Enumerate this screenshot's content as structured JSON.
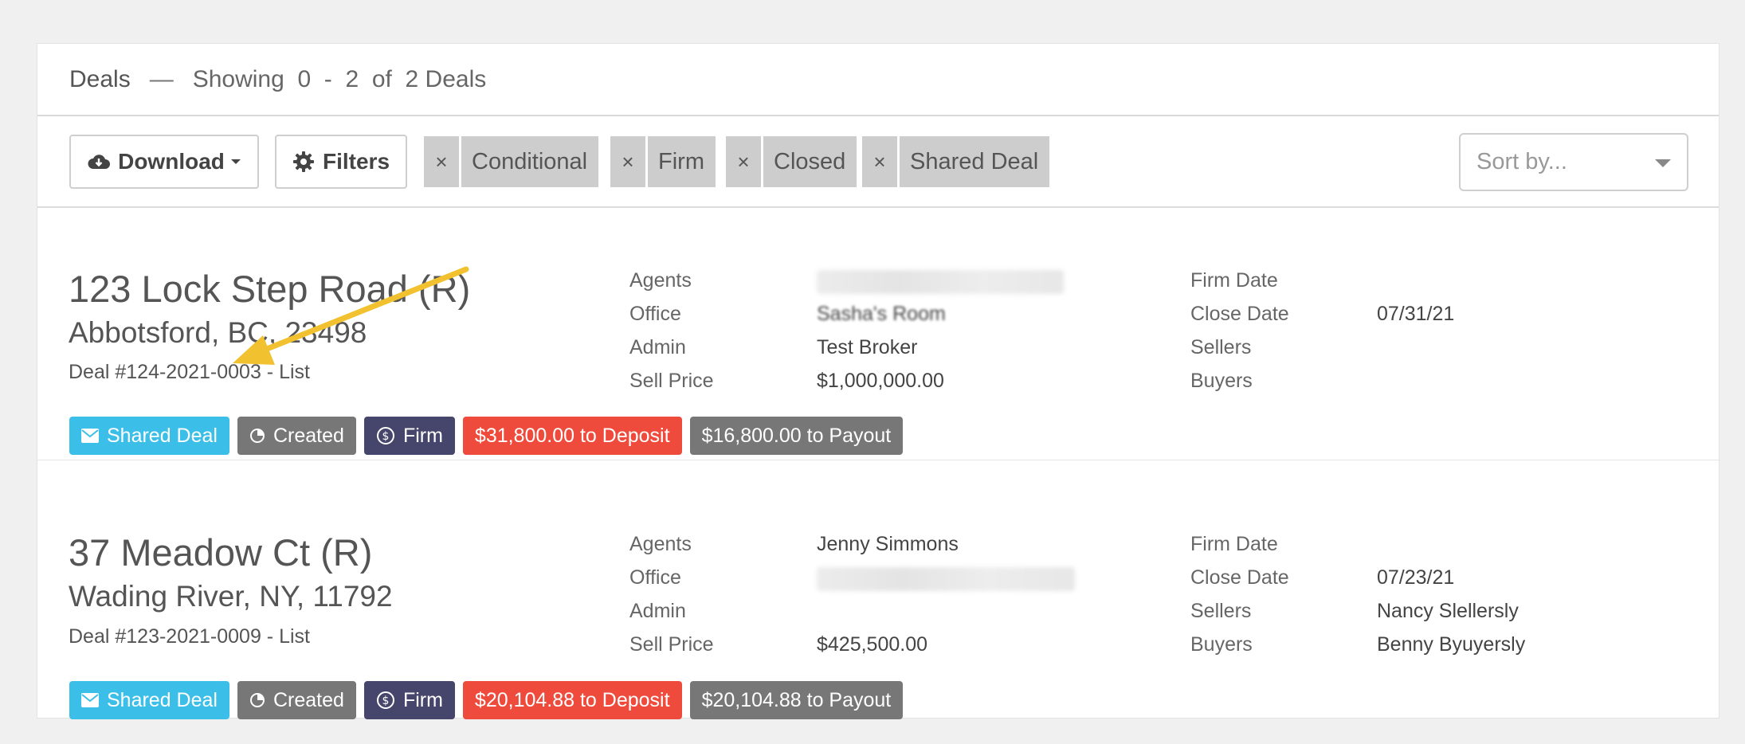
{
  "header": {
    "title": "Deals",
    "dash": "—",
    "showing": "Showing  0  -  2  of  2 Deals"
  },
  "toolbar": {
    "download_label": "Download",
    "filters_label": "Filters",
    "chips": [
      "Conditional",
      "Firm",
      "Closed",
      "Shared Deal"
    ],
    "chip_remove": "×",
    "sort_placeholder": "Sort by..."
  },
  "labels": {
    "agents": "Agents",
    "office": "Office",
    "admin": "Admin",
    "sell_price": "Sell Price",
    "firm_date": "Firm Date",
    "close_date": "Close Date",
    "sellers": "Sellers",
    "buyers": "Buyers"
  },
  "deals": [
    {
      "address": "123 Lock Step Road (R)",
      "city": "Abbotsford, BC, 23498",
      "deal_number": "Deal #124-2021-0003 - List",
      "office": "Sasha's Room",
      "admin": "Test Broker",
      "sell_price": "$1,000,000.00",
      "close_date": "07/31/21",
      "badges": {
        "shared": "Shared Deal",
        "created": "Created",
        "firm": "Firm",
        "deposit": "$31,800.00 to Deposit",
        "payout": "$16,800.00 to Payout"
      }
    },
    {
      "address": "37 Meadow Ct (R)",
      "city": "Wading River, NY, 11792",
      "deal_number": "Deal #123-2021-0009 - List",
      "agents": "Jenny Simmons",
      "close_date": "07/23/21",
      "sellers": "Nancy Slellersly",
      "buyers": "Benny Byuyersly",
      "sell_price": "$425,500.00",
      "badges": {
        "shared": "Shared Deal",
        "created": "Created",
        "firm": "Firm",
        "deposit": "$20,104.88 to Deposit",
        "payout": "$20,104.88 to Payout"
      }
    }
  ],
  "colors": {
    "shared": "#3bbfe8",
    "created": "#777777",
    "firm": "#46456c",
    "deposit": "#ef4b3c",
    "payout": "#777777",
    "annotation_arrow": "#f2c130"
  }
}
